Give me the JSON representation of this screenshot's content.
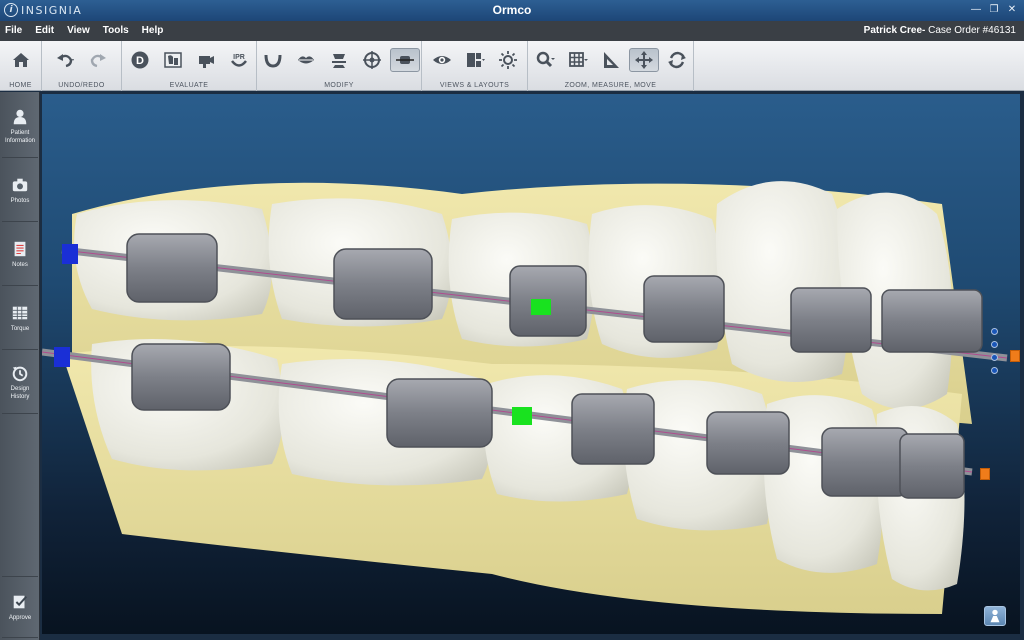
{
  "titlebar": {
    "logo_text": "INSIGNIA",
    "logo_mark": "i",
    "title": "Ormco"
  },
  "window_controls": {
    "minimize": "—",
    "restore": "❐",
    "close": "✕"
  },
  "menu": [
    "File",
    "Edit",
    "View",
    "Tools",
    "Help"
  ],
  "case": {
    "patient": "Patrick Cree",
    "separator": "-",
    "order": " Case Order #46131"
  },
  "toolbar_groups": {
    "home": "HOME",
    "undo_redo": "UNDO/REDO",
    "evaluate": "EVALUATE",
    "modify": "MODIFY",
    "views": "VIEWS & LAYOUTS",
    "zoom": "ZOOM, MEASURE, MOVE"
  },
  "tool_labels": {
    "d_tool": "D",
    "ipr_tool": "IPR"
  },
  "sidebar": [
    {
      "label": "Patient Information",
      "icon": "person-icon"
    },
    {
      "label": "Photos",
      "icon": "camera-icon"
    },
    {
      "label": "Notes",
      "icon": "notes-icon"
    },
    {
      "label": "Torque",
      "icon": "grid-icon"
    },
    {
      "label": "Design History",
      "icon": "history-icon"
    },
    {
      "label": "Approve",
      "icon": "approve-icon"
    }
  ],
  "colors": {
    "accent": "#1d4677",
    "selected_bracket": "#19e21f",
    "wire_end": "#f07c1a",
    "wire_marker": "#1a2fd6"
  }
}
